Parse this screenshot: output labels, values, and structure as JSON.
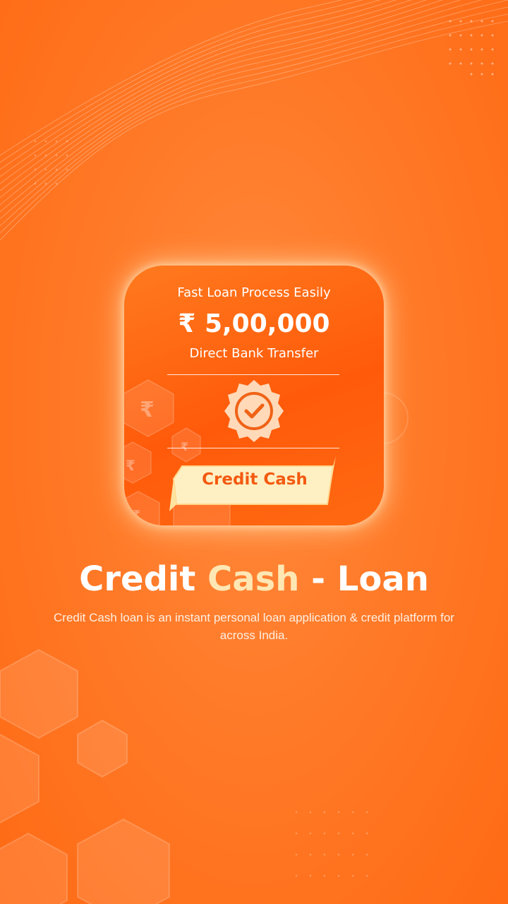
{
  "icon": {
    "tagline": "Fast Loan Process Easily",
    "amount": "₹ 5,00,000",
    "transfer": "Direct Bank Transfer",
    "ribbon_label": "Credit Cash",
    "currency_symbol": "₹"
  },
  "title": {
    "part1": "Credit",
    "part2": "Cash",
    "part3": "- Loan"
  },
  "description": "Credit Cash loan is an instant personal loan application & credit platform for across India.",
  "colors": {
    "background": "#ff7a28",
    "accent_text": "#ffe7b4",
    "ribbon_text": "#f35a10",
    "ribbon_fill": "#fff0c4"
  }
}
